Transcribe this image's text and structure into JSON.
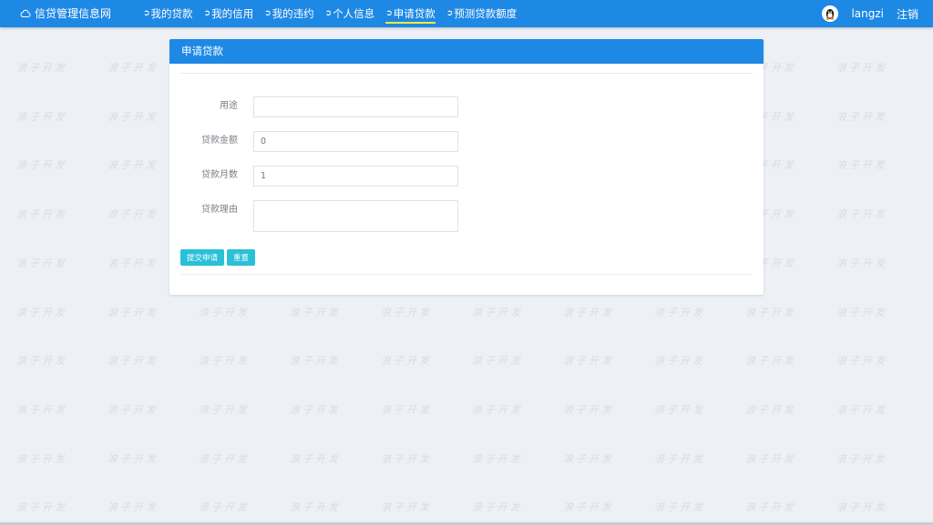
{
  "brand": {
    "title": "信贷管理信息网",
    "icon": "cloud-icon"
  },
  "nav": {
    "items": [
      {
        "label": "我的贷款",
        "icon": "circle-arrow-icon",
        "active": false
      },
      {
        "label": "我的信用",
        "icon": "circle-arrow-icon",
        "active": false
      },
      {
        "label": "我的违约",
        "icon": "circle-arrow-icon",
        "active": false
      },
      {
        "label": "个人信息",
        "icon": "circle-arrow-icon",
        "active": false
      },
      {
        "label": "申请贷款",
        "icon": "circle-arrow-icon",
        "active": true
      },
      {
        "label": "预测贷款额度",
        "icon": "circle-arrow-icon",
        "active": false
      }
    ]
  },
  "user": {
    "name": "langzi",
    "avatar": "qq-penguin-icon",
    "logout": "注销"
  },
  "card": {
    "title": "申请贷款"
  },
  "form": {
    "purpose": {
      "label": "用途",
      "value": ""
    },
    "amount": {
      "label": "贷款金额",
      "value": "0"
    },
    "months": {
      "label": "贷款月数",
      "value": "1"
    },
    "reason": {
      "label": "贷款理由",
      "value": ""
    }
  },
  "buttons": {
    "submit": "提交申请",
    "reset": "重置"
  },
  "watermark": {
    "text": "浪子开发"
  },
  "colors": {
    "primary": "#1e88e5",
    "button": "#29c0d8",
    "active_underline": "#ffeb3b",
    "background": "#edf1f5"
  }
}
